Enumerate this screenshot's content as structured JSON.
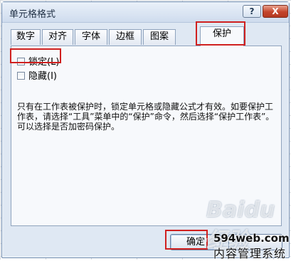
{
  "window": {
    "title": "单元格格式",
    "help_label": "?",
    "close_label": "X"
  },
  "tabs": [
    {
      "label": "数字"
    },
    {
      "label": "对齐"
    },
    {
      "label": "字体"
    },
    {
      "label": "边框"
    },
    {
      "label": "图案"
    },
    {
      "label": "保护",
      "active": true
    }
  ],
  "protection": {
    "locked_label": "锁定(L)",
    "locked_checked": false,
    "hidden_label": "隐藏(I)",
    "hidden_checked": false,
    "note": "只有在工作表被保护时，锁定单元格或隐藏公式才有效。如要保护工作表，请选择“工具”菜单中的“保护”命令，然后选择“保护工作表”。可以选择是否加密码保护。"
  },
  "buttons": {
    "ok_label": "确定",
    "cancel_label": ""
  },
  "watermark": {
    "baidu": "Baidu 经验",
    "small_text": "jingyan.baidu.com",
    "site_line1": "594web.com",
    "site_line2": "内容管理系统"
  },
  "colors": {
    "highlight": "#d0201f",
    "dialog_bg": "#dfe8f3"
  }
}
